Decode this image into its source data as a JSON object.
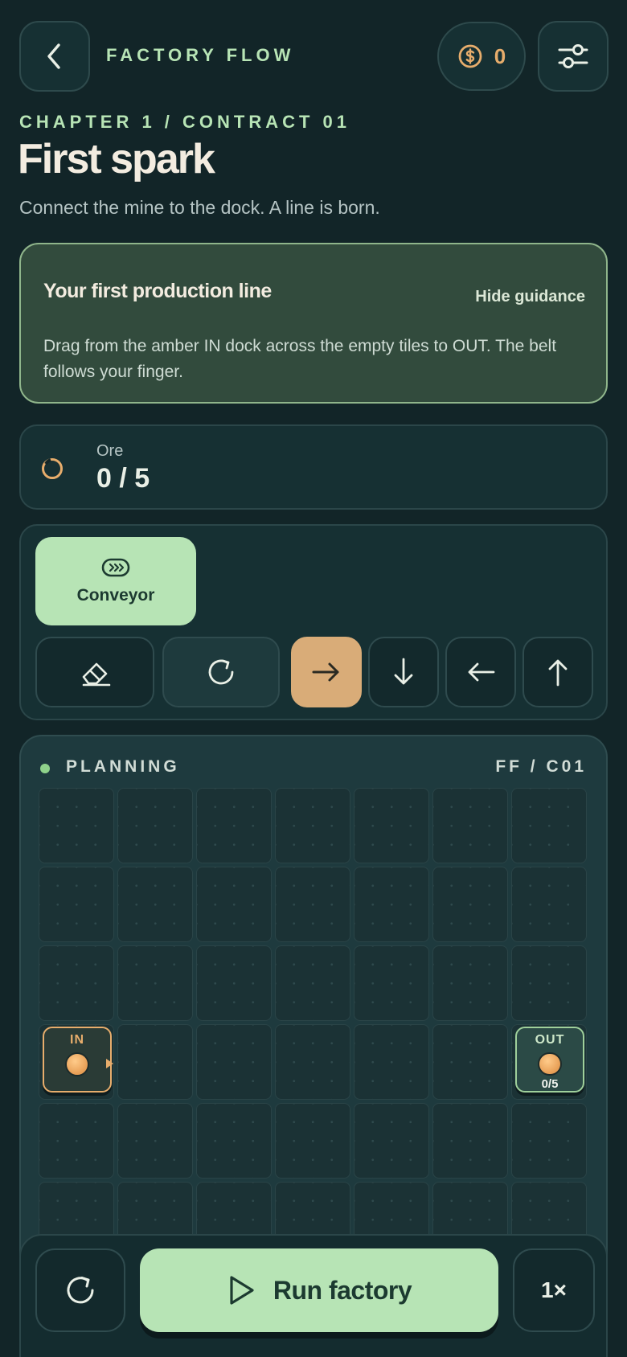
{
  "header": {
    "app_title": "FACTORY FLOW",
    "coins": "0",
    "icons": {
      "back": "chevron-left-icon",
      "coin": "dollar-coin-icon",
      "settings": "sliders-icon"
    }
  },
  "level": {
    "chapter": "CHAPTER 1 / CONTRACT 01",
    "title": "First spark",
    "subtitle": "Connect the mine to the dock. A line is born."
  },
  "guidance": {
    "title": "Your first production line",
    "hide_label": "Hide guidance",
    "body": "Drag from the amber IN dock across the empty tiles to OUT. The belt follows your finger."
  },
  "objective": {
    "label": "Ore",
    "value": "0 / 5",
    "icon": "ore-ring-icon"
  },
  "tools": {
    "selected_piece": "Conveyor",
    "buttons": [
      "eraser-icon",
      "rotate-icon",
      "arrow-right-icon",
      "arrow-down-icon",
      "arrow-left-icon",
      "arrow-up-icon"
    ],
    "active_direction": "right"
  },
  "board": {
    "status": "PLANNING",
    "code": "FF / C01",
    "rows": 7,
    "cols": 7,
    "in_dock": {
      "label": "IN",
      "row": 4,
      "col": 1
    },
    "out_dock": {
      "label": "OUT",
      "progress": "0/5",
      "row": 4,
      "col": 7
    }
  },
  "actions": {
    "run_label": "Run factory",
    "speed_label": "1×"
  },
  "colors": {
    "accent_green": "#b7e4b5",
    "amber": "#e7ad6c",
    "background": "#122528",
    "active_tool": "#d9ac78"
  }
}
